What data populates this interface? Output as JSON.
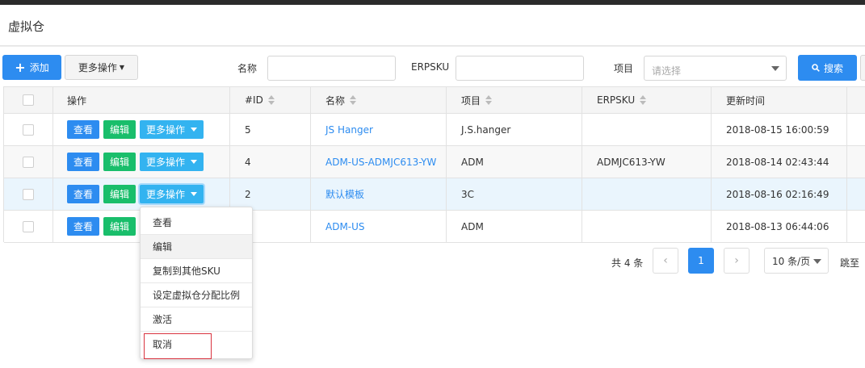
{
  "page": {
    "title": "虚拟仓"
  },
  "toolbar": {
    "add_label": "添加",
    "more_label": "更多操作",
    "filter_name_label": "名称",
    "filter_name_value": "",
    "filter_erpsku_label": "ERPSKU",
    "filter_erpsku_value": "",
    "filter_project_label": "项目",
    "filter_project_placeholder": "请选择",
    "search_label": "搜索"
  },
  "table": {
    "columns": [
      "操作",
      "#ID",
      "名称",
      "项目",
      "ERPSKU",
      "更新时间"
    ],
    "action_labels": {
      "view": "查看",
      "edit": "编辑",
      "more": "更多操作"
    },
    "rows": [
      {
        "id": "5",
        "name": "JS Hanger",
        "project": "J.S.hanger",
        "erpsku": "",
        "updated": "2018-08-15 16:00:59"
      },
      {
        "id": "4",
        "name": "ADM-US-ADMJC613-YW",
        "project": "ADM",
        "erpsku": "ADMJC613-YW",
        "updated": "2018-08-14 02:43:44"
      },
      {
        "id": "2",
        "name": "默认模板",
        "project": "3C",
        "erpsku": "",
        "updated": "2018-08-16 02:16:49"
      },
      {
        "id": "",
        "name": "ADM-US",
        "project": "ADM",
        "erpsku": "",
        "updated": "2018-08-13 06:44:06"
      }
    ]
  },
  "dropdown": {
    "items": [
      "查看",
      "编辑",
      "复制到其他SKU",
      "设定虚拟仓分配比例",
      "激活",
      "取消"
    ]
  },
  "pagination": {
    "total_text": "共 4 条",
    "prev": "‹",
    "current_page": "1",
    "next": "›",
    "page_size": "10 条/页",
    "jump_label": "跳至"
  },
  "colors": {
    "primary": "#2d8cf0",
    "success": "#19be6b",
    "info": "#33b3f0",
    "highlight_box": "#d9333f"
  }
}
